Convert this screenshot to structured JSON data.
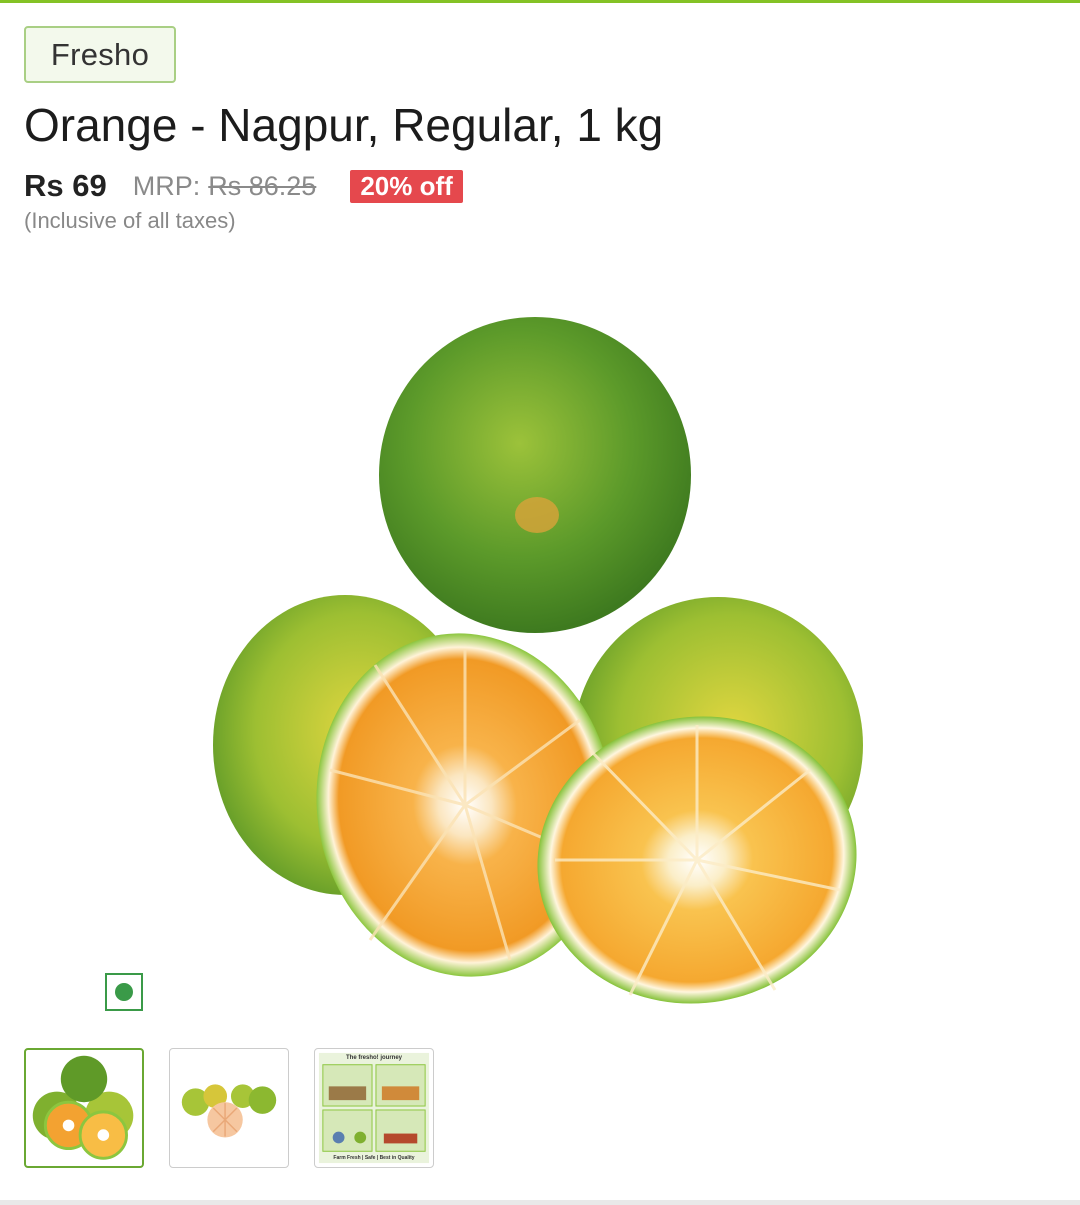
{
  "product": {
    "brand": "Fresho",
    "title": "Orange - Nagpur, Regular, 1 kg",
    "price": "Rs 69",
    "mrp_label": "MRP:",
    "mrp_value": "Rs 86.25",
    "discount": "20% off",
    "tax_note": "(Inclusive of all taxes)"
  },
  "gallery": {
    "main_image": "orange-fruit-pile",
    "thumbnails": [
      {
        "name": "orange-pile-thumb",
        "selected": true
      },
      {
        "name": "oranges-peeled-thumb",
        "selected": false
      },
      {
        "name": "fresho-journey-thumb",
        "selected": false
      }
    ],
    "journey_title": "The fresho! journey",
    "journey_footer": "Farm Fresh | Safe | Best in Quality"
  },
  "indicators": {
    "veg_icon": "veg-mark-icon"
  },
  "colors": {
    "accent_green": "#84c225",
    "discount_red": "#e5484d",
    "veg_green": "#3a9a48"
  }
}
